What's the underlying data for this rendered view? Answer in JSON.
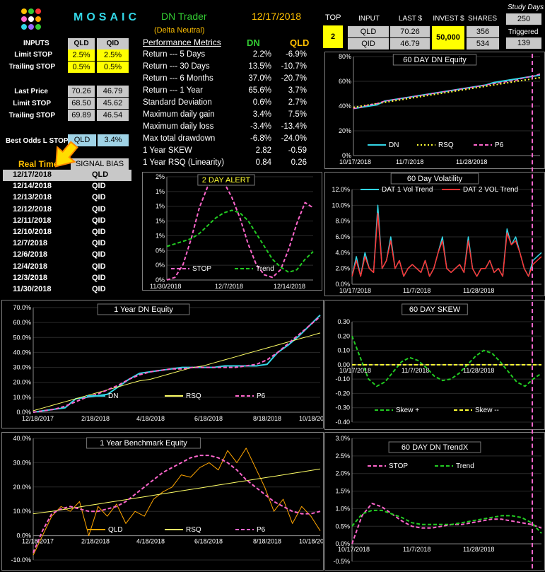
{
  "header": {
    "logo_text": "MOSAIC",
    "app_title": "DN Trader",
    "subtitle": "(Delta Neutral)",
    "date": "12/17/2018",
    "top_label": "TOP",
    "top_value": "2",
    "study_days_label": "Study Days",
    "study_days_value": "250",
    "triggered_label": "Triggered",
    "triggered_value": "139"
  },
  "invest_table": {
    "headers": [
      "INPUT",
      "LAST $",
      "INVEST $",
      "SHARES"
    ],
    "rows": [
      {
        "input": "QLD",
        "last": "70.26",
        "shares": "356"
      },
      {
        "input": "QID",
        "last": "46.79",
        "shares": "534"
      }
    ],
    "invest": "50,000"
  },
  "inputs": {
    "header": "INPUTS",
    "col1": "QLD",
    "col2": "QID",
    "rows": [
      {
        "label": "Limit STOP",
        "v1": "2.5%",
        "v2": "2.5%"
      },
      {
        "label": "Trailing STOP",
        "v1": "0.5%",
        "v2": "0.5%"
      }
    ]
  },
  "prices": {
    "rows": [
      {
        "label": "Last Price",
        "v1": "70.26",
        "v2": "46.79"
      },
      {
        "label": "Limit STOP",
        "v1": "68.50",
        "v2": "45.62"
      },
      {
        "label": "Trailing STOP",
        "v1": "69.89",
        "v2": "46.54"
      }
    ]
  },
  "best_odds": {
    "label": "Best Odds  L STOP",
    "symbol": "QLD",
    "value": "3.4%"
  },
  "signals": {
    "realtime_label": "Real Time",
    "bias_label": "SIGNAL BIAS",
    "rows": [
      {
        "date": "12/17/2018",
        "bias": "QLD"
      },
      {
        "date": "12/14/2018",
        "bias": "QID"
      },
      {
        "date": "12/13/2018",
        "bias": "QID"
      },
      {
        "date": "12/12/2018",
        "bias": "QID"
      },
      {
        "date": "12/11/2018",
        "bias": "QID"
      },
      {
        "date": "12/10/2018",
        "bias": "QID"
      },
      {
        "date": "12/7/2018",
        "bias": "QID"
      },
      {
        "date": "12/6/2018",
        "bias": "QID"
      },
      {
        "date": "12/4/2018",
        "bias": "QID"
      },
      {
        "date": "12/3/2018",
        "bias": "QID"
      },
      {
        "date": "11/30/2018",
        "bias": "QID"
      }
    ]
  },
  "metrics": {
    "title": "Performance Metrics",
    "col1": "DN",
    "col2": "QLD",
    "rows": [
      {
        "label": "Return --- 5 Days",
        "dn": "2.2%",
        "qld": "-6.9%"
      },
      {
        "label": "Return --- 30 Days",
        "dn": "13.5%",
        "qld": "-10.7%"
      },
      {
        "label": "Return --- 6 Months",
        "dn": "37.0%",
        "qld": "-20.7%"
      },
      {
        "label": "Return --- 1 Year",
        "dn": "65.6%",
        "qld": "3.7%"
      },
      {
        "label": "Standard Deviation",
        "dn": "0.6%",
        "qld": "2.7%"
      },
      {
        "label": "Maximum daily gain",
        "dn": "3.4%",
        "qld": "7.5%"
      },
      {
        "label": "Maximum daily loss",
        "dn": "-3.4%",
        "qld": "-13.4%"
      },
      {
        "label": "Max total drawdown",
        "dn": "-6.8%",
        "qld": "-24.0%"
      },
      {
        "label": "1 Year SKEW",
        "dn": "2.82",
        "qld": "-0.59"
      },
      {
        "label": "1 Year RSQ  (Linearity)",
        "dn": "0.84",
        "qld": "0.26"
      }
    ]
  },
  "colors": {
    "gold": "#ffc000",
    "green": "#33cc33",
    "cyan": "#33d6e6",
    "pink": "#ff66cc",
    "yellow": "#ffff33",
    "red": "#ff3333",
    "orange": "#ffa500",
    "lime": "#22cc22"
  },
  "chart_data": [
    {
      "id": "dn-equity-60",
      "type": "line",
      "title": "60 DAY DN  Equity",
      "ylim": [
        0,
        80
      ],
      "yticks": [
        "0%",
        "20%",
        "40%",
        "60%",
        "80%"
      ],
      "xticks": [
        "10/17/2018",
        "11/7/2018",
        "11/28/2018"
      ],
      "legend": [
        "DN",
        "RSQ",
        "P6"
      ],
      "series": [
        {
          "name": "DN",
          "values": [
            38,
            39,
            40,
            41,
            44,
            45,
            46,
            47,
            48,
            49,
            50,
            51,
            52,
            53,
            54,
            55,
            56,
            57,
            59,
            60,
            61,
            62,
            63,
            64,
            65
          ]
        },
        {
          "name": "RSQ",
          "values": [
            39,
            40,
            41,
            42,
            43,
            44,
            45,
            46,
            47,
            48,
            49,
            50,
            51,
            52,
            53,
            54,
            55,
            56,
            57,
            58,
            59,
            60,
            61,
            62,
            63
          ]
        },
        {
          "name": "P6",
          "values": [
            38,
            39,
            41,
            42,
            44,
            45,
            46,
            47,
            48,
            49,
            50,
            51,
            52,
            53,
            54,
            55,
            56,
            57,
            58,
            59,
            60,
            61,
            63,
            64,
            66
          ]
        }
      ]
    },
    {
      "id": "two-day-alert",
      "type": "line",
      "title": "2 DAY ALERT",
      "ylim": [
        0,
        2
      ],
      "yticks": [
        "0%",
        "0%",
        "0%",
        "1%",
        "1%",
        "1%",
        "1%",
        "2%"
      ],
      "xticks": [
        "11/30/2018",
        "12/7/2018",
        "12/14/2018"
      ],
      "legend": [
        "STOP",
        "Trend"
      ],
      "series": [
        {
          "name": "STOP",
          "values": [
            0.0,
            0.05,
            0.3,
            0.8,
            1.4,
            1.8,
            1.95,
            1.9,
            1.6,
            1.2,
            0.7,
            0.3,
            0.1,
            0.05,
            0.2,
            0.6,
            1.1,
            1.5,
            1.4
          ]
        },
        {
          "name": "Trend",
          "values": [
            0.65,
            0.7,
            0.75,
            0.8,
            0.9,
            1.05,
            1.2,
            1.3,
            1.35,
            1.3,
            1.15,
            0.9,
            0.65,
            0.4,
            0.25,
            0.15,
            0.2,
            0.4,
            0.55
          ]
        }
      ]
    },
    {
      "id": "volatility-60",
      "type": "line",
      "title": "60 Day  Volatility",
      "ylim": [
        0,
        12
      ],
      "yticks": [
        "0.0%",
        "2.0%",
        "4.0%",
        "6.0%",
        "8.0%",
        "10.0%",
        "12.0%"
      ],
      "xticks": [
        "10/17/2018",
        "11/7/2018",
        "11/28/2018"
      ],
      "legend": [
        "DAT 1 Vol Trend",
        "DAT 2 VOL Trend"
      ],
      "series": [
        {
          "name": "DAT 1 Vol Trend",
          "values": [
            1,
            3.5,
            1,
            4,
            2,
            1.5,
            10,
            2,
            3,
            6,
            2,
            3,
            1,
            2,
            2.5,
            2,
            1.5,
            3,
            1,
            2,
            4,
            6,
            2,
            1.5,
            2,
            2.5,
            1.5,
            6,
            2,
            1,
            2,
            2,
            3,
            1.5,
            2,
            1,
            7,
            5,
            6,
            4,
            2,
            1,
            3,
            3.5,
            4
          ]
        },
        {
          "name": "DAT 2 VOL Trend",
          "values": [
            1,
            3,
            1,
            3.5,
            2,
            1.5,
            9,
            2,
            3,
            5.5,
            2,
            3,
            1,
            2,
            2.5,
            2,
            1.5,
            3,
            1,
            2,
            4,
            5.5,
            2,
            1.5,
            2,
            2.5,
            1.5,
            5.5,
            2,
            1,
            2,
            2,
            3,
            1.5,
            2,
            1,
            6.5,
            5,
            5.5,
            4,
            2,
            1,
            2.5,
            3,
            3.5
          ]
        }
      ]
    },
    {
      "id": "dn-equity-1y",
      "type": "line",
      "title": "1 Year  DN   Equity",
      "ylim": [
        0,
        70
      ],
      "yticks": [
        "0.0%",
        "10.0%",
        "20.0%",
        "30.0%",
        "40.0%",
        "50.0%",
        "60.0%",
        "70.0%"
      ],
      "xticks": [
        "12/18/2017",
        "2/18/2018",
        "4/18/2018",
        "6/18/2018",
        "8/18/2018",
        "10/18/2018"
      ],
      "legend": [
        "DN",
        "RSQ",
        "P6"
      ],
      "series": [
        {
          "name": "DN",
          "values": [
            0,
            1,
            2,
            3,
            9,
            10,
            11,
            12,
            17,
            22,
            26,
            27,
            28,
            29,
            30,
            30,
            30,
            30,
            31,
            31,
            31,
            31,
            32,
            40,
            45,
            51,
            58,
            65
          ]
        },
        {
          "name": "RSQ",
          "values": [
            1,
            3,
            5,
            7,
            9,
            11,
            13,
            15,
            17,
            19,
            21,
            22,
            24,
            26,
            28,
            30,
            31,
            33,
            35,
            37,
            39,
            41,
            43,
            45,
            47,
            49,
            51,
            53
          ]
        },
        {
          "name": "P6",
          "values": [
            0,
            1,
            2,
            4,
            7,
            10,
            12,
            15,
            18,
            22,
            25,
            27,
            28,
            29,
            29,
            30,
            30,
            30,
            30,
            30,
            31,
            32,
            35,
            40,
            46,
            52,
            58,
            64
          ]
        }
      ]
    },
    {
      "id": "skew-60",
      "type": "line",
      "title": "60  DAY  SKEW",
      "ylim": [
        -0.4,
        0.3
      ],
      "yticks": [
        "-0.40",
        "-0.30",
        "-0.20",
        "-0.10",
        "0.00",
        "0.10",
        "0.20",
        "0.30"
      ],
      "xticks": [
        "10/17/2018",
        "11/7/2018",
        "11/28/2018"
      ],
      "legend": [
        "Skew +",
        "Skew --"
      ],
      "series": [
        {
          "name": "Skew +",
          "values": [
            0.2,
            0.05,
            -0.1,
            -0.15,
            -0.12,
            -0.05,
            0.02,
            0.05,
            0.03,
            -0.02,
            -0.08,
            -0.11,
            -0.1,
            -0.06,
            0.0,
            0.06,
            0.1,
            0.08,
            0.02,
            -0.05,
            -0.12,
            -0.15,
            -0.1,
            -0.06
          ]
        },
        {
          "name": "Skew --",
          "values": [
            0,
            0,
            0,
            0,
            0,
            0,
            0,
            0,
            0,
            0,
            0,
            0,
            0,
            0,
            0,
            0,
            0,
            0,
            0,
            0,
            0,
            0,
            0,
            0
          ]
        }
      ]
    },
    {
      "id": "benchmark-1y",
      "type": "line",
      "title": "1 Year  Benchmark Equity",
      "ylim": [
        -10,
        40
      ],
      "yticks": [
        "-10.0%",
        "0.0%",
        "10.0%",
        "20.0%",
        "30.0%",
        "40.0%"
      ],
      "xticks": [
        "12/18/2017",
        "2/18/2018",
        "4/18/2018",
        "6/18/2018",
        "8/18/2018",
        "10/18/2018"
      ],
      "legend": [
        "QLD",
        "RSQ",
        "P6"
      ],
      "series": [
        {
          "name": "QLD",
          "values": [
            -8,
            0,
            8,
            12,
            10,
            14,
            0,
            12,
            8,
            13,
            5,
            10,
            8,
            15,
            18,
            20,
            25,
            24,
            28,
            30,
            27,
            35,
            30,
            36,
            28,
            20,
            10,
            15,
            5,
            12,
            8,
            2
          ]
        },
        {
          "name": "RSQ",
          "values": [
            9,
            9.5,
            10,
            10.6,
            11.2,
            11.8,
            12.4,
            13,
            13.6,
            14.2,
            14.8,
            15.4,
            16,
            16.6,
            17.2,
            17.8,
            18.4,
            19,
            19.6,
            20.2,
            20.8,
            21.4,
            22,
            22.6,
            23.2,
            23.8,
            24.4,
            25,
            25.6,
            26.2,
            26.8,
            27.4
          ]
        },
        {
          "name": "P6",
          "values": [
            -7,
            2,
            9,
            11,
            12,
            11,
            10,
            10,
            11,
            12,
            14,
            17,
            20,
            23,
            26,
            28,
            30,
            32,
            33,
            33,
            32,
            30,
            27,
            23,
            20,
            17,
            14,
            12,
            10,
            9,
            9,
            10
          ]
        }
      ]
    },
    {
      "id": "dn-trendx-60",
      "type": "line",
      "title": "60  DAY  DN  TrendX",
      "ylim": [
        -0.5,
        3.0
      ],
      "yticks": [
        "-0.5%",
        "0.0%",
        "0.5%",
        "1.0%",
        "1.5%",
        "2.0%",
        "2.5%",
        "3.0%"
      ],
      "xticks": [
        "10/17/2018",
        "11/7/2018",
        "11/28/2018"
      ],
      "legend": [
        "STOP",
        "Trend"
      ],
      "series": [
        {
          "name": "STOP",
          "values": [
            0.0,
            0.8,
            1.15,
            1.05,
            0.85,
            0.65,
            0.5,
            0.45,
            0.45,
            0.5,
            0.55,
            0.55,
            0.6,
            0.65,
            0.7,
            0.7,
            0.65,
            0.6,
            0.55,
            0.45
          ]
        },
        {
          "name": "Trend",
          "values": [
            0.5,
            0.85,
            0.95,
            0.95,
            0.85,
            0.75,
            0.6,
            0.55,
            0.55,
            0.55,
            0.55,
            0.6,
            0.65,
            0.7,
            0.75,
            0.8,
            0.8,
            0.75,
            0.6,
            0.3
          ]
        }
      ]
    }
  ]
}
